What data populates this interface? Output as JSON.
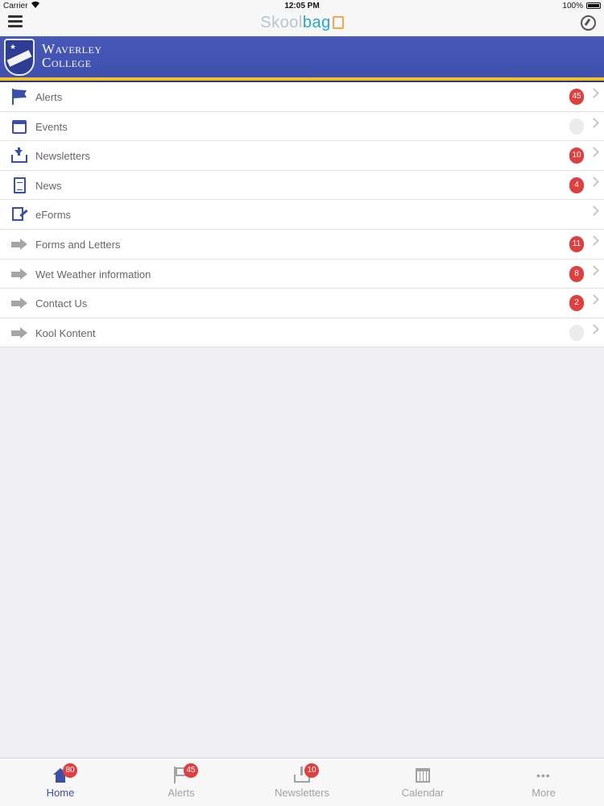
{
  "status_bar": {
    "carrier": "Carrier",
    "time": "12:05 PM",
    "battery": "100%"
  },
  "nav_bar": {
    "logo_skool": "Skool",
    "logo_bag": "bag"
  },
  "banner": {
    "name_line1": "Waverley",
    "name_line2": "College"
  },
  "menu": [
    {
      "label": "Alerts",
      "badge": "45",
      "icon": "flag-icon"
    },
    {
      "label": "Events",
      "badge": "",
      "icon": "calendar-icon"
    },
    {
      "label": "Newsletters",
      "badge": "10",
      "icon": "inbox-download-icon"
    },
    {
      "label": "News",
      "badge": "4",
      "icon": "document-icon"
    },
    {
      "label": "eForms",
      "badge": null,
      "icon": "form-pen-icon"
    },
    {
      "label": "Forms and Letters",
      "badge": "11",
      "icon": "arrow-right-icon"
    },
    {
      "label": "Wet Weather information",
      "badge": "8",
      "icon": "arrow-right-icon"
    },
    {
      "label": "Contact Us",
      "badge": "2",
      "icon": "arrow-right-icon"
    },
    {
      "label": "Kool Kontent",
      "badge": "",
      "icon": "arrow-right-icon"
    }
  ],
  "tabs": [
    {
      "label": "Home",
      "badge": "80",
      "icon": "home-icon",
      "active": true
    },
    {
      "label": "Alerts",
      "badge": "45",
      "icon": "flag-icon",
      "active": false
    },
    {
      "label": "Newsletters",
      "badge": "10",
      "icon": "inbox-download-icon",
      "active": false
    },
    {
      "label": "Calendar",
      "badge": null,
      "icon": "calendar-icon",
      "active": false
    },
    {
      "label": "More",
      "badge": null,
      "icon": "more-dots-icon",
      "active": false
    }
  ],
  "colors": {
    "brand_blue": "#3a4fa8",
    "banner_gold": "#f0c22a",
    "badge_red": "#e03f3f"
  }
}
